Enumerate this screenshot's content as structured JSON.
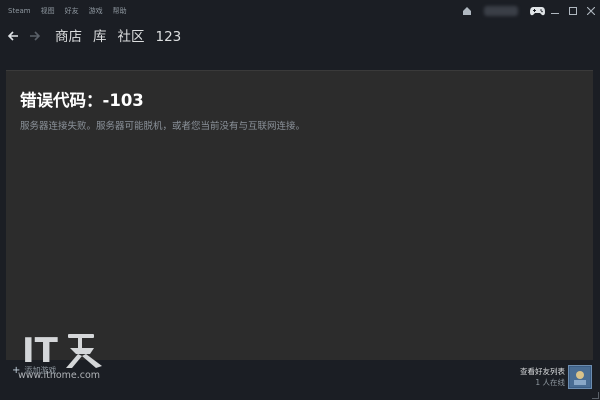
{
  "menu": {
    "items": [
      "Steam",
      "视图",
      "好友",
      "游戏",
      "帮助"
    ]
  },
  "nav": {
    "back_icon": "arrow-left",
    "forward_icon": "arrow-right",
    "links": [
      "商店",
      "库",
      "社区",
      "123"
    ]
  },
  "content": {
    "title": "错误代码：-103",
    "description": "服务器连接失败。服务器可能脱机，或者您当前没有与互联网连接。"
  },
  "bottom": {
    "add_game": "添加游戏",
    "friends_label": "查看好友列表",
    "friends_count": "1 人在线"
  },
  "watermark": {
    "logo_text": "IT之家",
    "url": "www.ithome.com"
  },
  "colors": {
    "background": "#1b1e24",
    "panel": "#2c2c2c",
    "title_text": "#ffffff",
    "muted_text": "#8b929a"
  }
}
